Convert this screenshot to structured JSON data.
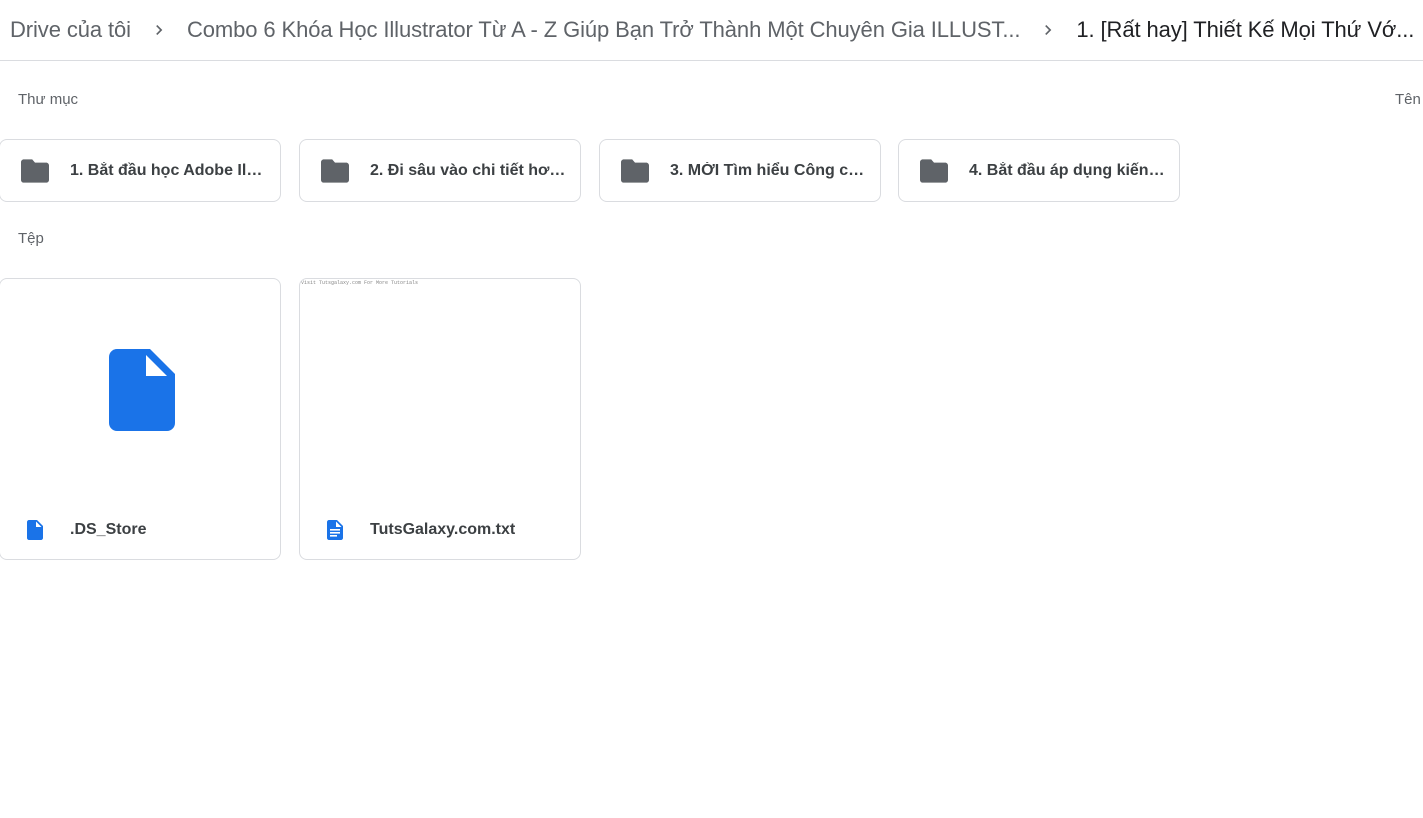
{
  "breadcrumb": {
    "items": [
      {
        "label": "Drive của tôi"
      },
      {
        "label": "Combo 6 Khóa Học Illustrator Từ A - Z Giúp Bạn Trở Thành Một Chuyên Gia ILLUST..."
      },
      {
        "label": "1. [Rất hay] Thiết Kế Mọi Thứ Vớ..."
      }
    ],
    "separator_icon": "chevron-right-icon"
  },
  "sections": {
    "folders_label": "Thư mục",
    "files_label": "Tệp",
    "sort_label": "Tên"
  },
  "folders": [
    {
      "name": "1. Bắt đầu học Adobe Illu...",
      "icon": "folder-icon"
    },
    {
      "name": "2. Đi sâu vào chi tiết hơn ...",
      "icon": "folder-icon"
    },
    {
      "name": "3. MỚI Tìm hiểu Công cụ ...",
      "icon": "folder-icon"
    },
    {
      "name": "4. Bắt đầu áp dụng kiến t...",
      "icon": "folder-icon"
    }
  ],
  "files": [
    {
      "name": ".DS_Store",
      "icon": "file-icon",
      "thumbnail": "generic-file-icon"
    },
    {
      "name": "TutsGalaxy.com.txt",
      "icon": "text-document-icon",
      "thumbnail": "text-preview",
      "preview_text": "Visit Tutsgalaxy.com For More Tutorials"
    }
  ],
  "colors": {
    "accent_blue": "#1a73e8",
    "icon_grey": "#5f6368",
    "border": "#dadce0"
  }
}
